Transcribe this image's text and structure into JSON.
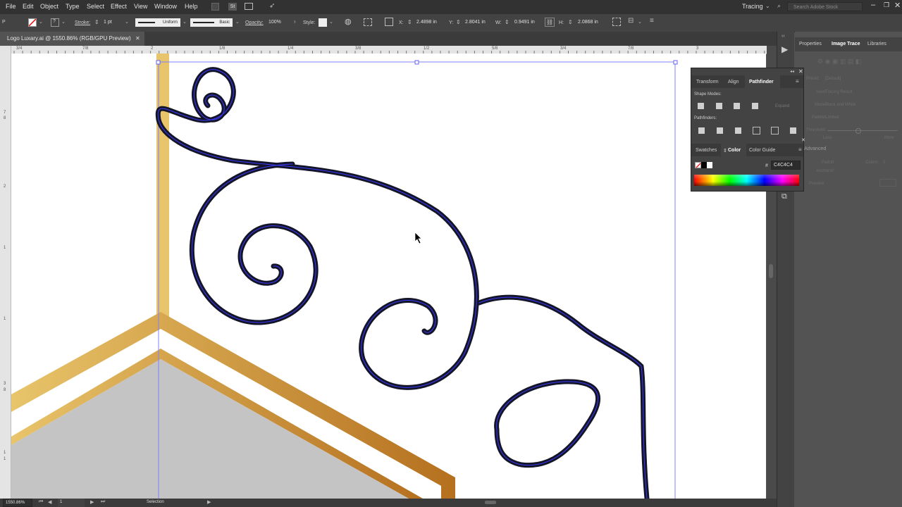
{
  "menu": [
    "File",
    "Edit",
    "Object",
    "Type",
    "Select",
    "Effect",
    "View",
    "Window",
    "Help"
  ],
  "workspace": "Tracing",
  "stock_placeholder": "Search Adobe Stock",
  "control": {
    "stroke_label": "Stroke:",
    "stroke_weight": "1 pt",
    "profile_label": "Uniform",
    "brush_label": "Basic",
    "opacity_label": "Opacity:",
    "opacity_value": "100%",
    "style_label": "Style:",
    "x_label": "X:",
    "x_value": "2.4898 in",
    "y_label": "Y:",
    "y_value": "2.8041 in",
    "w_label": "W:",
    "w_value": "0.9491 in",
    "h_label": "H:",
    "h_value": "2.0868 in"
  },
  "document_tab": "Logo Luxary.ai @ 1550.86% (RGB/GPU Preview)",
  "ruler_h": [
    "3/4",
    "7/8",
    "2",
    "1/8",
    "1/4",
    "3/8",
    "1/2",
    "5/8",
    "3/4",
    "7/8",
    "3"
  ],
  "ruler_v": [
    "7",
    "8",
    "2",
    "1",
    "1",
    "3",
    "8",
    "1",
    "1"
  ],
  "right_panel": {
    "tabs": [
      "Properties",
      "Image Trace",
      "Libraries"
    ],
    "ghost_rows": [
      "Preset:",
      "[Default]",
      "View:",
      "Tracing Result",
      "Mode:",
      "Black and White",
      "Palette:",
      "Limited",
      "Threshold:",
      "Less",
      "More",
      "Advanced",
      "Paths:",
      "0",
      "Colors:",
      "0",
      "Anchors:",
      "0",
      "Preview"
    ]
  },
  "pathfinder": {
    "tabs": [
      "Transform",
      "Align",
      "Pathfinder"
    ],
    "shape_modes": "Shape Modes:",
    "expand": "Expand",
    "pathfinders": "Pathfinders:"
  },
  "color_panel": {
    "tabs": [
      "Swatches",
      "Color",
      "Color Guide"
    ],
    "hash": "#",
    "hex": "C4C4C4"
  },
  "status": {
    "zoom": "1550.86%",
    "artboard": "1",
    "tool": "Selection"
  },
  "colors": {
    "gold_light": "#e8c46a",
    "gold_dark": "#b5701e",
    "gray_fill": "#c4c4c4",
    "selection_blue": "#3c3cff"
  }
}
